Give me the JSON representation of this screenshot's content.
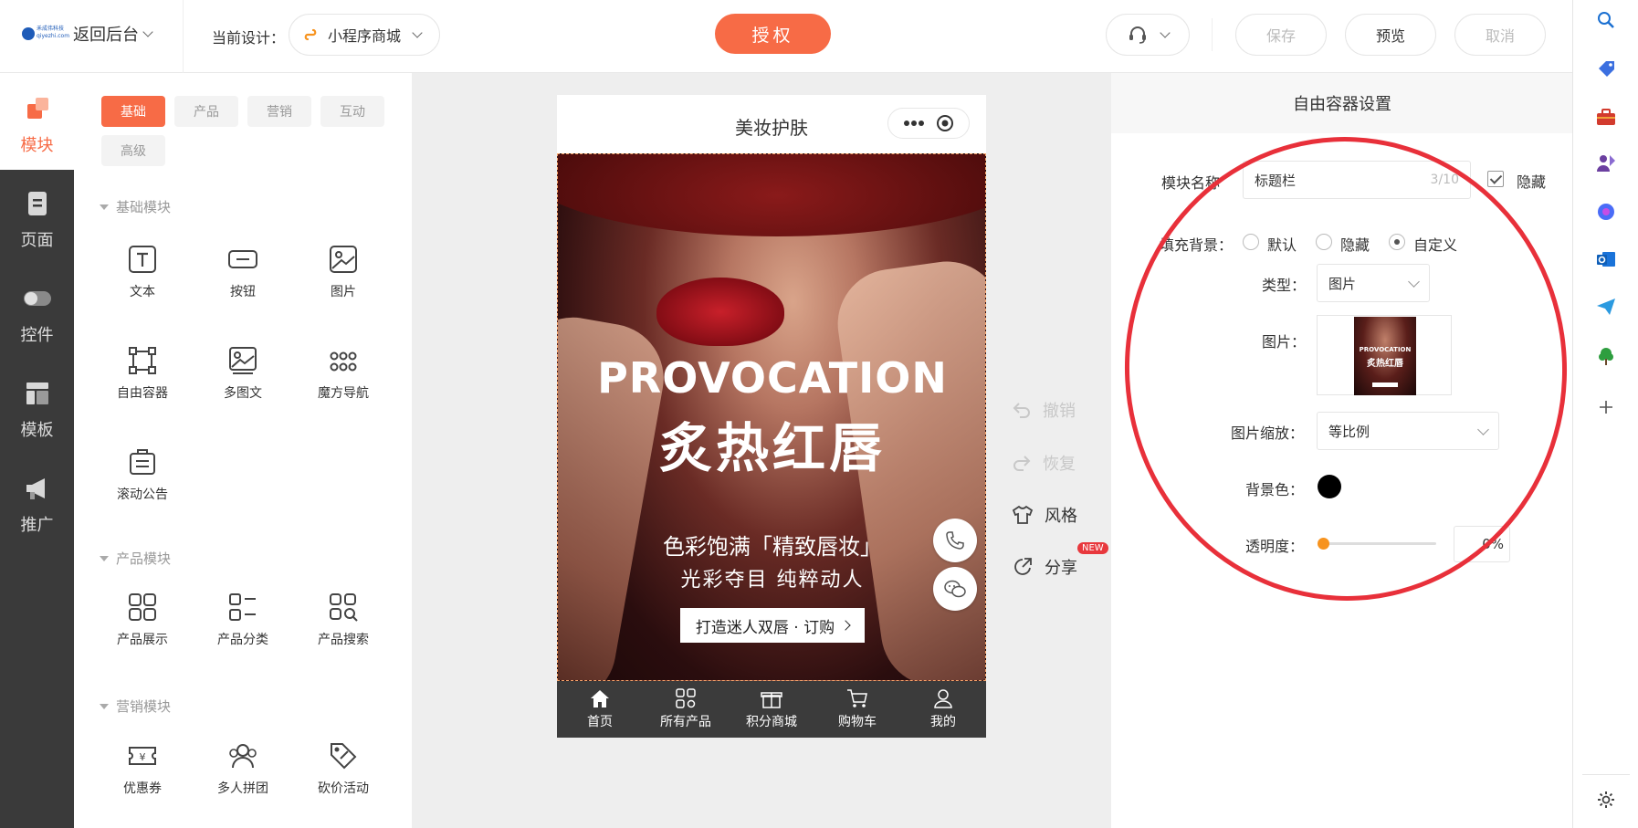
{
  "topbar": {
    "logo_text": "禾成伟科技 qiyezhi.com",
    "back_label": "返回后台",
    "current_design_label": "当前设计：",
    "design_name": "小程序商城",
    "auth_label": "授权",
    "save_label": "保存",
    "preview_label": "预览",
    "cancel_label": "取消"
  },
  "leftnav": {
    "items": [
      {
        "label": "模块",
        "icon": "module-icon",
        "active": true
      },
      {
        "label": "页面",
        "icon": "page-icon"
      },
      {
        "label": "控件",
        "icon": "toggle-icon"
      },
      {
        "label": "模板",
        "icon": "template-icon"
      },
      {
        "label": "推广",
        "icon": "megaphone-icon"
      }
    ]
  },
  "components": {
    "tabs": [
      "基础",
      "产品",
      "营销",
      "互动",
      "高级"
    ],
    "active_tab": "基础",
    "sections": [
      {
        "title": "基础模块",
        "items": [
          "文本",
          "按钮",
          "图片",
          "自由容器",
          "多图文",
          "魔方导航",
          "滚动公告"
        ]
      },
      {
        "title": "产品模块",
        "items": [
          "产品展示",
          "产品分类",
          "产品搜索"
        ]
      },
      {
        "title": "营销模块",
        "items": [
          "优惠券",
          "多人拼团",
          "砍价活动"
        ]
      }
    ]
  },
  "phone": {
    "title": "美妆护肤",
    "banner": {
      "headline_en": "PROVOCATION",
      "headline_cn": "炙热红唇",
      "subline1": "色彩饱满「精致唇妆」",
      "subline2": "光彩夺目  纯粹动人",
      "button_label": "打造迷人双唇 · 订购"
    },
    "tabbar": [
      "首页",
      "所有产品",
      "积分商城",
      "购物车",
      "我的"
    ]
  },
  "side_tools": {
    "undo": "撤销",
    "redo": "恢复",
    "style": "风格",
    "share": "分享",
    "new_badge": "NEW"
  },
  "settings": {
    "title": "自由容器设置",
    "module_name_label": "模块名称",
    "module_name_value": "标题栏",
    "module_name_count": "3/10",
    "hide_label": "隐藏",
    "fill_bg_label": "填充背景：",
    "fill_options": [
      "默认",
      "隐藏",
      "自定义"
    ],
    "fill_selected": "自定义",
    "type_label": "类型：",
    "type_value": "图片",
    "image_label": "图片：",
    "thumb_en": "PROVOCATION",
    "thumb_cn": "炙热红唇",
    "scale_label": "图片缩放：",
    "scale_value": "等比例",
    "bg_color_label": "背景色：",
    "bg_color": "#000000",
    "opacity_label": "透明度：",
    "opacity_value": "0%"
  },
  "colors": {
    "accent": "#f76b46",
    "annotation_circle": "#e8303a"
  }
}
